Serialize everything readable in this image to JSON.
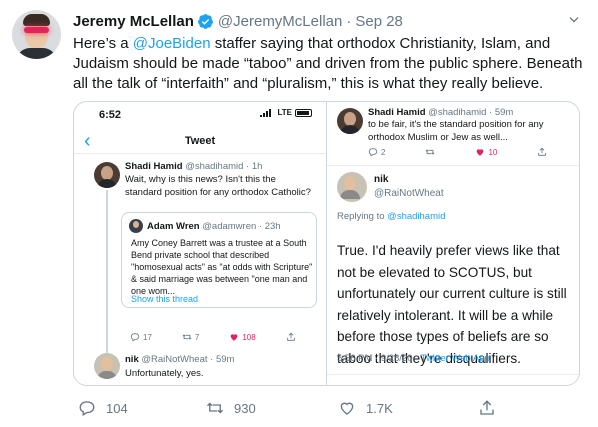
{
  "tweet": {
    "author_name": "Jeremy McLellan",
    "author_handle": "@JeremyMcLellan",
    "separator": "·",
    "date": "Sep 28",
    "text_before": "Here’s a ",
    "mention": "@JoeBiden",
    "text_after": " staffer saying that orthodox Christianity, Islam, and Judaism should be made “taboo” and driven from the public sphere. Beneath all the talk of “interfaith” and “pluralism,” this is what they really believe.",
    "counts": {
      "replies": "104",
      "retweets": "930",
      "likes": "1.7K"
    }
  },
  "left_screenshot": {
    "status_time": "6:52",
    "status_network": "LTE",
    "nav_title": "Tweet",
    "tweet1": {
      "name": "Shadi Hamid",
      "handle": "@shadihamid · 1h",
      "text": "Wait, why is this news? Isn't this the standard position for any orthodox Catholic?",
      "quote": {
        "name": "Adam Wren",
        "handle": "@adamwren · 23h",
        "text": "Amy Coney Barrett was a trustee at a South Bend private school that described \"homosexual acts\" as \"at odds with Scripture\" & said marriage was between \"one man and one wom...",
        "link": "Show this thread"
      },
      "replies": "17",
      "retweets": "7",
      "likes": "108"
    },
    "tweet2": {
      "name": "nik",
      "handle": "@RaiNotWheat · 59m",
      "text": "Unfortunately, yes."
    }
  },
  "right_screenshot": {
    "tweet1": {
      "name": "Shadi Hamid",
      "handle": "@shadihamid · 59m",
      "text": "to be fair, it's the standard position for any orthodox Muslim or Jew as well...",
      "replies": "2",
      "likes": "10"
    },
    "tweet2": {
      "name": "nik",
      "handle": "@RaiNotWheat",
      "replying_label": "Replying to ",
      "replying_mention": "@shadihamid",
      "text": "True. I'd heavily prefer views like that not be elevated to SCOTUS, but unfortunately our current culture is still relatively intolerant. It will be a while before those types of beliefs are so taboo that they're disqualifiers.",
      "timestamp": "5:56 PM · 9/28/20 · ",
      "source": "Twitter Web App"
    }
  },
  "colors": {
    "link": "#1da1f2",
    "muted": "#657786",
    "like": "#e0245e",
    "text": "#14171a"
  },
  "icons": [
    "verified-icon",
    "chevron-down-icon",
    "reply-icon",
    "retweet-icon",
    "like-icon",
    "share-icon",
    "back-icon",
    "battery-icon"
  ]
}
